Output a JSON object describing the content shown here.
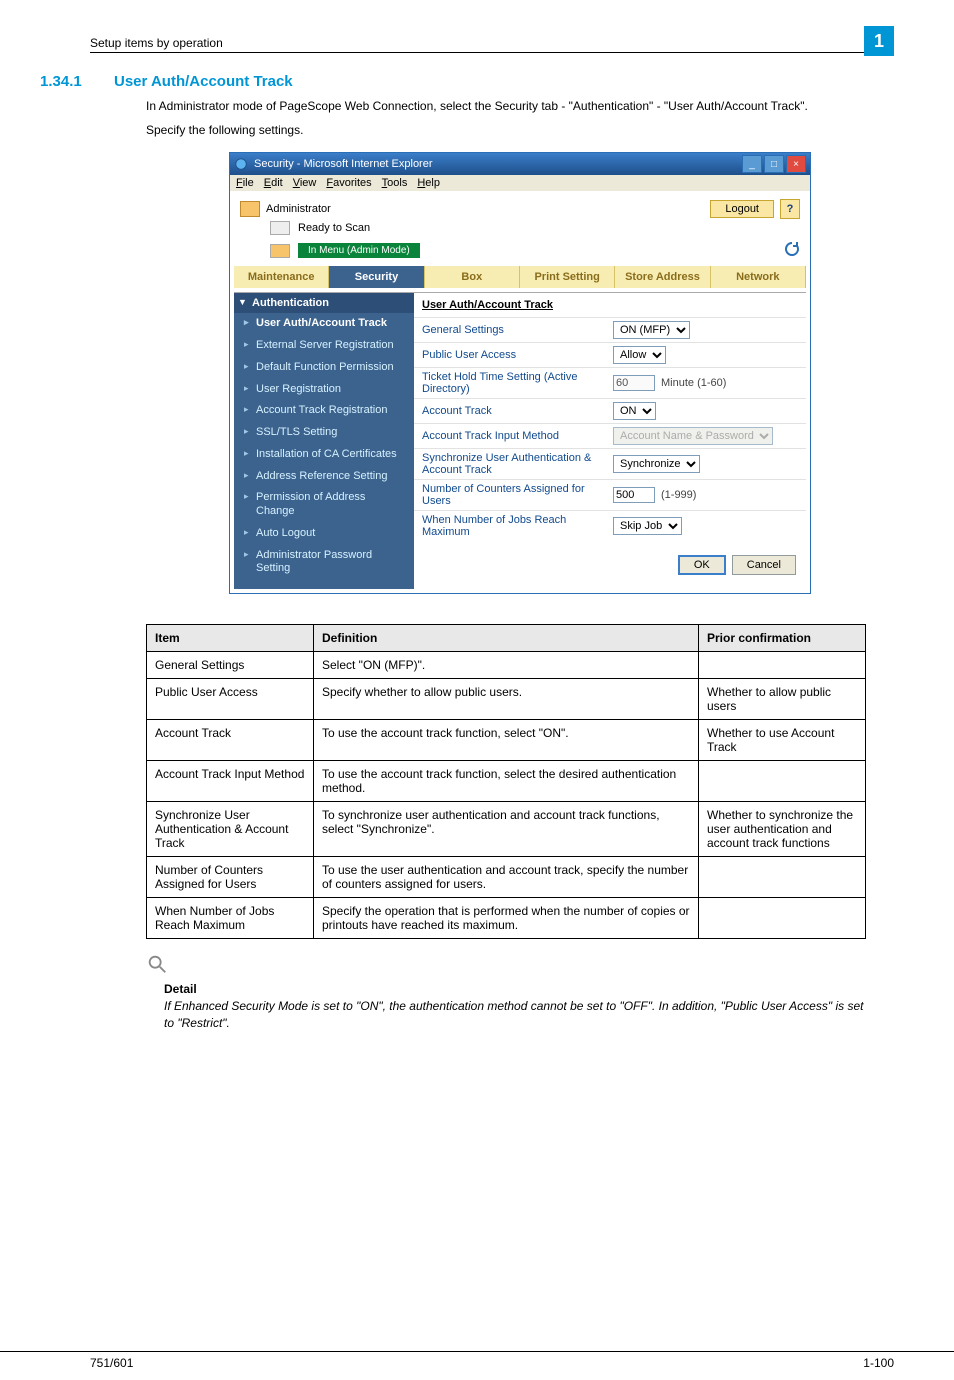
{
  "header": {
    "running_title": "Setup items by operation",
    "page_badge": "1"
  },
  "section": {
    "number": "1.34.1",
    "title": "User Auth/Account Track",
    "p1": "In Administrator mode of PageScope Web Connection, select the Security tab - \"Authentication\" - \"User Auth/Account Track\".",
    "p2": "Specify the following settings."
  },
  "ie": {
    "window_title": "Security - Microsoft Internet Explorer",
    "menus": [
      "File",
      "Edit",
      "View",
      "Favorites",
      "Tools",
      "Help"
    ],
    "admin_label": "Administrator",
    "logout": "Logout",
    "ready": "Ready to Scan",
    "mode_badge": "In Menu (Admin Mode)",
    "tabs": [
      "Maintenance",
      "Security",
      "Box",
      "Print Setting",
      "Store Address",
      "Network"
    ],
    "active_tab_index": 1,
    "side_header": "Authentication",
    "side_items": [
      "User Auth/Account Track",
      "External Server Registration",
      "Default Function Permission",
      "User Registration",
      "Account Track Registration",
      "SSL/TLS Setting",
      "Installation of CA Certificates",
      "Address Reference Setting",
      "Permission of Address Change",
      "Auto Logout",
      "Administrator Password Setting"
    ],
    "pane_title": "User Auth/Account Track",
    "form": {
      "general_label": "General Settings",
      "general_value": "ON (MFP)",
      "public_label": "Public User Access",
      "public_value": "Allow",
      "ticket_label": "Ticket Hold Time Setting (Active Directory)",
      "ticket_value": "60",
      "ticket_unit": "Minute (1-60)",
      "track_label": "Account Track",
      "track_value": "ON",
      "method_label": "Account Track Input Method",
      "method_value": "Account Name & Password",
      "sync_label": "Synchronize User Authentication & Account Track",
      "sync_value": "Synchronize",
      "counters_label": "Number of Counters Assigned for Users",
      "counters_value": "500",
      "counters_unit": "(1-999)",
      "reach_label": "When Number of Jobs Reach Maximum",
      "reach_value": "Skip Job"
    },
    "buttons": {
      "ok": "OK",
      "cancel": "Cancel"
    }
  },
  "def_table": {
    "headers": [
      "Item",
      "Definition",
      "Prior confirmation"
    ],
    "rows": [
      {
        "item": "General Settings",
        "def": "Select \"ON (MFP)\".",
        "prior": ""
      },
      {
        "item": "Public User Access",
        "def": "Specify whether to allow public users.",
        "prior": "Whether to allow public users"
      },
      {
        "item": "Account Track",
        "def": "To use the account track function, select \"ON\".",
        "prior": "Whether to use Account Track"
      },
      {
        "item": "Account Track Input Method",
        "def": "To use the account track function, select the desired authentication method.",
        "prior": ""
      },
      {
        "item": "Synchronize User Authentication & Account Track",
        "def": "To synchronize user authentication and account track functions, select \"Synchronize\".",
        "prior": "Whether to synchronize the user authentication and account track functions"
      },
      {
        "item": "Number of Counters Assigned for Users",
        "def": "To use the user authentication and account track, specify the number of counters assigned for users.",
        "prior": ""
      },
      {
        "item": "When Number of Jobs Reach Maximum",
        "def": "Specify the operation that is performed when the number of copies or printouts have reached its maximum.",
        "prior": ""
      }
    ]
  },
  "detail": {
    "heading": "Detail",
    "body": "If Enhanced Security Mode is set to \"ON\", the authentication method cannot be set to \"OFF\". In addition, \"Public User Access\" is set to \"Restrict\"."
  },
  "footer": {
    "left": "751/601",
    "right": "1-100"
  }
}
